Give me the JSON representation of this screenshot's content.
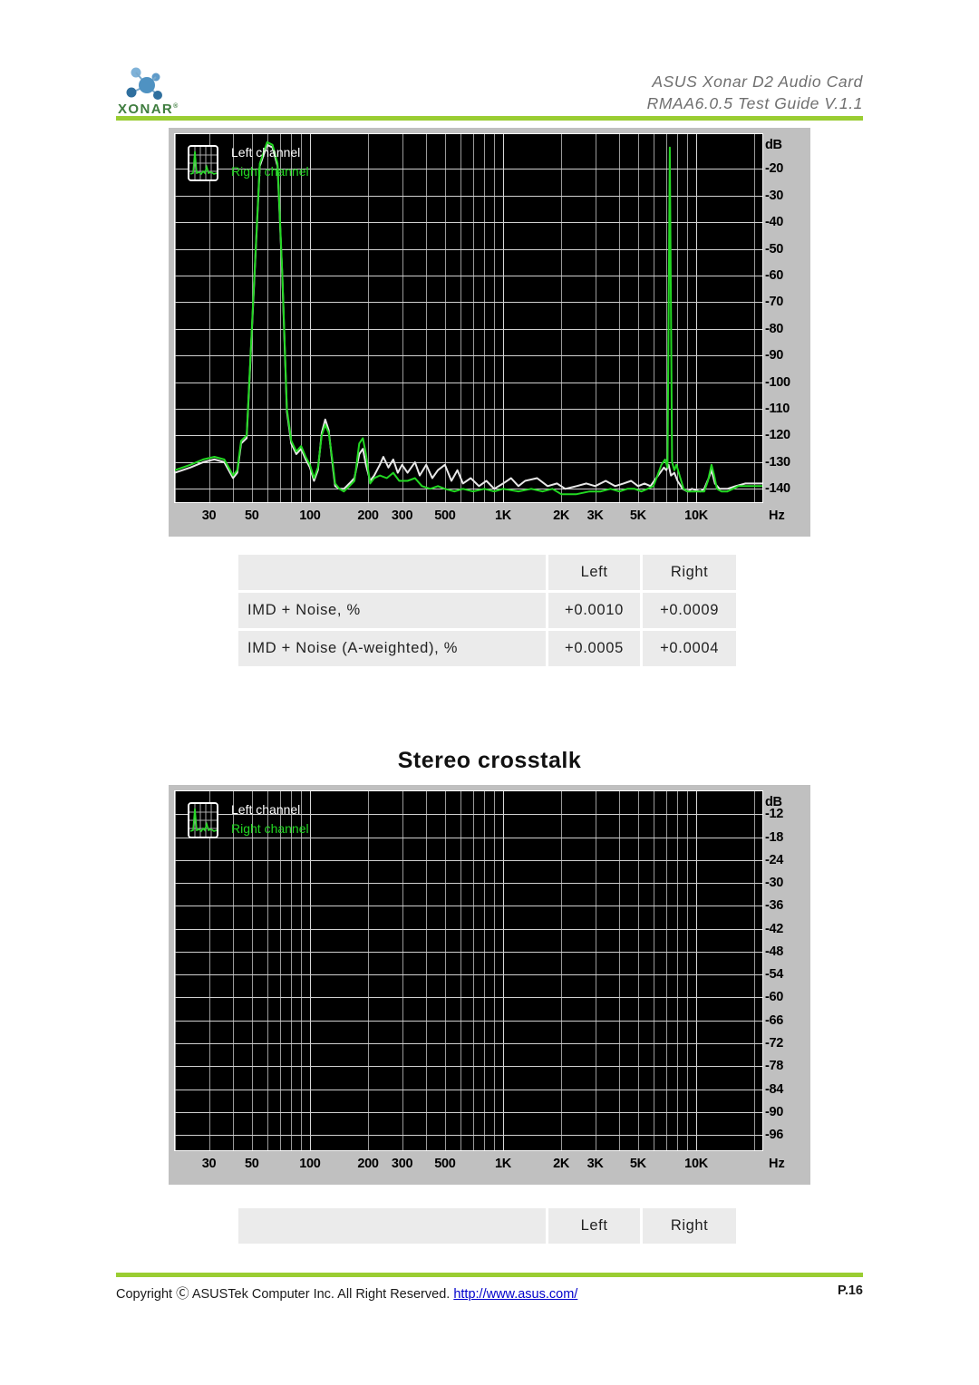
{
  "header": {
    "logo_text": "XONAR",
    "logo_tm": "®",
    "title_line1": "ASUS  Xonar  D2  Audio  Card",
    "title_line2": "RMAA6.0.5  Test  Guide  V.1.1",
    "rule_color": "#9ACD32"
  },
  "footer": {
    "copyright_prefix": "Copyright Ⓒ ASUSTek Computer Inc. All Right Reserved. ",
    "url": "http://www.asus.com/",
    "page": "P.16",
    "rule_color": "#9ACD32"
  },
  "section": {
    "stereo_crosstalk_title": "Stereo crosstalk"
  },
  "legend": {
    "left_label": "Left channel",
    "right_label": "Right channel",
    "left_color": "#ffffff",
    "right_color": "#22d822",
    "icon_name": "spectrum-thumbnail-icon"
  },
  "imd_table": {
    "columns": [
      "",
      "Left",
      "Right"
    ],
    "rows": [
      {
        "label": "IMD +  Noise, %",
        "left": "+0.0010",
        "right": "+0.0009"
      },
      {
        "label": "IMD +  Noise (A-weighted), %",
        "left": "+0.0005",
        "right": "+0.0004"
      }
    ]
  },
  "crosstalk_table": {
    "columns": [
      "",
      "Left",
      "Right"
    ],
    "rows": []
  },
  "chart_data": [
    {
      "id": "imd-spectrum",
      "type": "line",
      "title": "",
      "xlabel": "Hz",
      "ylabel": "dB",
      "xscale": "log",
      "xlim": [
        20,
        22000
      ],
      "ylim": [
        -145,
        -7
      ],
      "grid": true,
      "xtick_labels": [
        "30",
        "50",
        "100",
        "200",
        "300",
        "500",
        "1K",
        "2K",
        "3K",
        "5K",
        "10K"
      ],
      "xtick_values": [
        30,
        50,
        100,
        200,
        300,
        500,
        1000,
        2000,
        3000,
        5000,
        10000
      ],
      "ytick_labels": [
        "-20",
        "-30",
        "-40",
        "-50",
        "-60",
        "-70",
        "-80",
        "-90",
        "-100",
        "-110",
        "-120",
        "-130",
        "-140"
      ],
      "ytick_values": [
        -20,
        -30,
        -40,
        -50,
        -60,
        -70,
        -80,
        -90,
        -100,
        -110,
        -120,
        -130,
        -140
      ],
      "legend": [
        "Left channel",
        "Right channel"
      ],
      "series": [
        {
          "name": "Right channel",
          "color": "#22d822",
          "points": [
            [
              20,
              -133
            ],
            [
              24,
              -131
            ],
            [
              28,
              -129
            ],
            [
              32,
              -128
            ],
            [
              36,
              -129
            ],
            [
              40,
              -135
            ],
            [
              42,
              -133
            ],
            [
              44,
              -122
            ],
            [
              47,
              -120
            ],
            [
              50,
              -80
            ],
            [
              55,
              -18
            ],
            [
              60,
              -10
            ],
            [
              64,
              -11
            ],
            [
              68,
              -18
            ],
            [
              72,
              -60
            ],
            [
              76,
              -110
            ],
            [
              80,
              -122
            ],
            [
              85,
              -126
            ],
            [
              90,
              -124
            ],
            [
              95,
              -128
            ],
            [
              100,
              -131
            ],
            [
              105,
              -136
            ],
            [
              110,
              -132
            ],
            [
              115,
              -120
            ],
            [
              120,
              -116
            ],
            [
              125,
              -119
            ],
            [
              130,
              -128
            ],
            [
              135,
              -138
            ],
            [
              142,
              -140
            ],
            [
              150,
              -141
            ],
            [
              160,
              -139
            ],
            [
              170,
              -137
            ],
            [
              180,
              -123
            ],
            [
              188,
              -121
            ],
            [
              195,
              -127
            ],
            [
              205,
              -138
            ],
            [
              215,
              -136
            ],
            [
              230,
              -135
            ],
            [
              250,
              -136
            ],
            [
              270,
              -134
            ],
            [
              290,
              -137
            ],
            [
              320,
              -137
            ],
            [
              350,
              -136
            ],
            [
              380,
              -139
            ],
            [
              420,
              -140
            ],
            [
              460,
              -139
            ],
            [
              500,
              -140
            ],
            [
              560,
              -141
            ],
            [
              620,
              -140
            ],
            [
              700,
              -141
            ],
            [
              800,
              -140
            ],
            [
              900,
              -141
            ],
            [
              1000,
              -140
            ],
            [
              1200,
              -141
            ],
            [
              1400,
              -140
            ],
            [
              1600,
              -141
            ],
            [
              1800,
              -140
            ],
            [
              2000,
              -142
            ],
            [
              2400,
              -142
            ],
            [
              2800,
              -141
            ],
            [
              3200,
              -141
            ],
            [
              3600,
              -140
            ],
            [
              4000,
              -141
            ],
            [
              4400,
              -140
            ],
            [
              4800,
              -140
            ],
            [
              5200,
              -141
            ],
            [
              5600,
              -140
            ],
            [
              6000,
              -139
            ],
            [
              6300,
              -135
            ],
            [
              6600,
              -131
            ],
            [
              6900,
              -129
            ],
            [
              7100,
              -132
            ],
            [
              7300,
              -12
            ],
            [
              7500,
              -130
            ],
            [
              7700,
              -133
            ],
            [
              7900,
              -131
            ],
            [
              8200,
              -135
            ],
            [
              8600,
              -140
            ],
            [
              9000,
              -141
            ],
            [
              9500,
              -141
            ],
            [
              10000,
              -141
            ],
            [
              10500,
              -141
            ],
            [
              11000,
              -141
            ],
            [
              11500,
              -137
            ],
            [
              12000,
              -131
            ],
            [
              12400,
              -135
            ],
            [
              12800,
              -140
            ],
            [
              13500,
              -141
            ],
            [
              14500,
              -141
            ],
            [
              15500,
              -140
            ],
            [
              16500,
              -139
            ],
            [
              18000,
              -139
            ],
            [
              20000,
              -139
            ],
            [
              22000,
              -139
            ]
          ]
        },
        {
          "name": "Left channel",
          "color": "#e8e8e8",
          "points": [
            [
              20,
              -134
            ],
            [
              24,
              -132
            ],
            [
              28,
              -130
            ],
            [
              32,
              -129
            ],
            [
              36,
              -130
            ],
            [
              40,
              -136
            ],
            [
              42,
              -134
            ],
            [
              44,
              -123
            ],
            [
              47,
              -121
            ],
            [
              50,
              -81
            ],
            [
              55,
              -19
            ],
            [
              60,
              -11
            ],
            [
              64,
              -12
            ],
            [
              68,
              -19
            ],
            [
              72,
              -61
            ],
            [
              76,
              -111
            ],
            [
              80,
              -123
            ],
            [
              85,
              -127
            ],
            [
              90,
              -125
            ],
            [
              95,
              -129
            ],
            [
              100,
              -132
            ],
            [
              105,
              -137
            ],
            [
              110,
              -133
            ],
            [
              115,
              -119
            ],
            [
              120,
              -114
            ],
            [
              125,
              -118
            ],
            [
              130,
              -129
            ],
            [
              135,
              -139
            ],
            [
              142,
              -140
            ],
            [
              150,
              -140
            ],
            [
              160,
              -138
            ],
            [
              170,
              -136
            ],
            [
              180,
              -127
            ],
            [
              188,
              -125
            ],
            [
              195,
              -131
            ],
            [
              205,
              -137
            ],
            [
              215,
              -135
            ],
            [
              230,
              -131
            ],
            [
              240,
              -128
            ],
            [
              255,
              -132
            ],
            [
              270,
              -129
            ],
            [
              285,
              -134
            ],
            [
              300,
              -131
            ],
            [
              320,
              -134
            ],
            [
              350,
              -130
            ],
            [
              370,
              -135
            ],
            [
              400,
              -131
            ],
            [
              430,
              -136
            ],
            [
              460,
              -133
            ],
            [
              500,
              -131
            ],
            [
              540,
              -137
            ],
            [
              580,
              -133
            ],
            [
              620,
              -138
            ],
            [
              680,
              -136
            ],
            [
              750,
              -139
            ],
            [
              820,
              -137
            ],
            [
              900,
              -140
            ],
            [
              1000,
              -138
            ],
            [
              1100,
              -136
            ],
            [
              1200,
              -139
            ],
            [
              1300,
              -137
            ],
            [
              1500,
              -136
            ],
            [
              1700,
              -139
            ],
            [
              1900,
              -138
            ],
            [
              2100,
              -140
            ],
            [
              2400,
              -139
            ],
            [
              2700,
              -138
            ],
            [
              3000,
              -139
            ],
            [
              3400,
              -137
            ],
            [
              3800,
              -139
            ],
            [
              4200,
              -138
            ],
            [
              4600,
              -137
            ],
            [
              5000,
              -139
            ],
            [
              5400,
              -138
            ],
            [
              5800,
              -139
            ],
            [
              6200,
              -136
            ],
            [
              6500,
              -134
            ],
            [
              6800,
              -132
            ],
            [
              7000,
              -133
            ],
            [
              7200,
              -131
            ],
            [
              7400,
              -135
            ],
            [
              7700,
              -134
            ],
            [
              8000,
              -137
            ],
            [
              8500,
              -140
            ],
            [
              9000,
              -141
            ],
            [
              9500,
              -140
            ],
            [
              10500,
              -141
            ],
            [
              11000,
              -140
            ],
            [
              11600,
              -136
            ],
            [
              12000,
              -133
            ],
            [
              12500,
              -138
            ],
            [
              13200,
              -140
            ],
            [
              14500,
              -140
            ],
            [
              16000,
              -139
            ],
            [
              18000,
              -138
            ],
            [
              20000,
              -138
            ],
            [
              22000,
              -138
            ]
          ]
        }
      ]
    },
    {
      "id": "stereo-crosstalk-spectrum",
      "type": "line",
      "title": "Stereo crosstalk",
      "xlabel": "Hz",
      "ylabel": "dB",
      "xscale": "log",
      "xlim": [
        20,
        22000
      ],
      "ylim": [
        -100,
        -6
      ],
      "grid": true,
      "xtick_labels": [
        "30",
        "50",
        "100",
        "200",
        "300",
        "500",
        "1K",
        "2K",
        "3K",
        "5K",
        "10K"
      ],
      "xtick_values": [
        30,
        50,
        100,
        200,
        300,
        500,
        1000,
        2000,
        3000,
        5000,
        10000
      ],
      "ytick_labels": [
        "-12",
        "-18",
        "-24",
        "-30",
        "-36",
        "-42",
        "-48",
        "-54",
        "-60",
        "-66",
        "-72",
        "-78",
        "-84",
        "-90",
        "-96"
      ],
      "ytick_values": [
        -12,
        -18,
        -24,
        -30,
        -36,
        -42,
        -48,
        -54,
        -60,
        -66,
        -72,
        -78,
        -84,
        -90,
        -96
      ],
      "legend": [
        "Left channel",
        "Right channel"
      ],
      "series": [
        {
          "name": "Right channel",
          "color": "#22d822",
          "points": []
        },
        {
          "name": "Left channel",
          "color": "#e8e8e8",
          "points": []
        }
      ]
    }
  ]
}
